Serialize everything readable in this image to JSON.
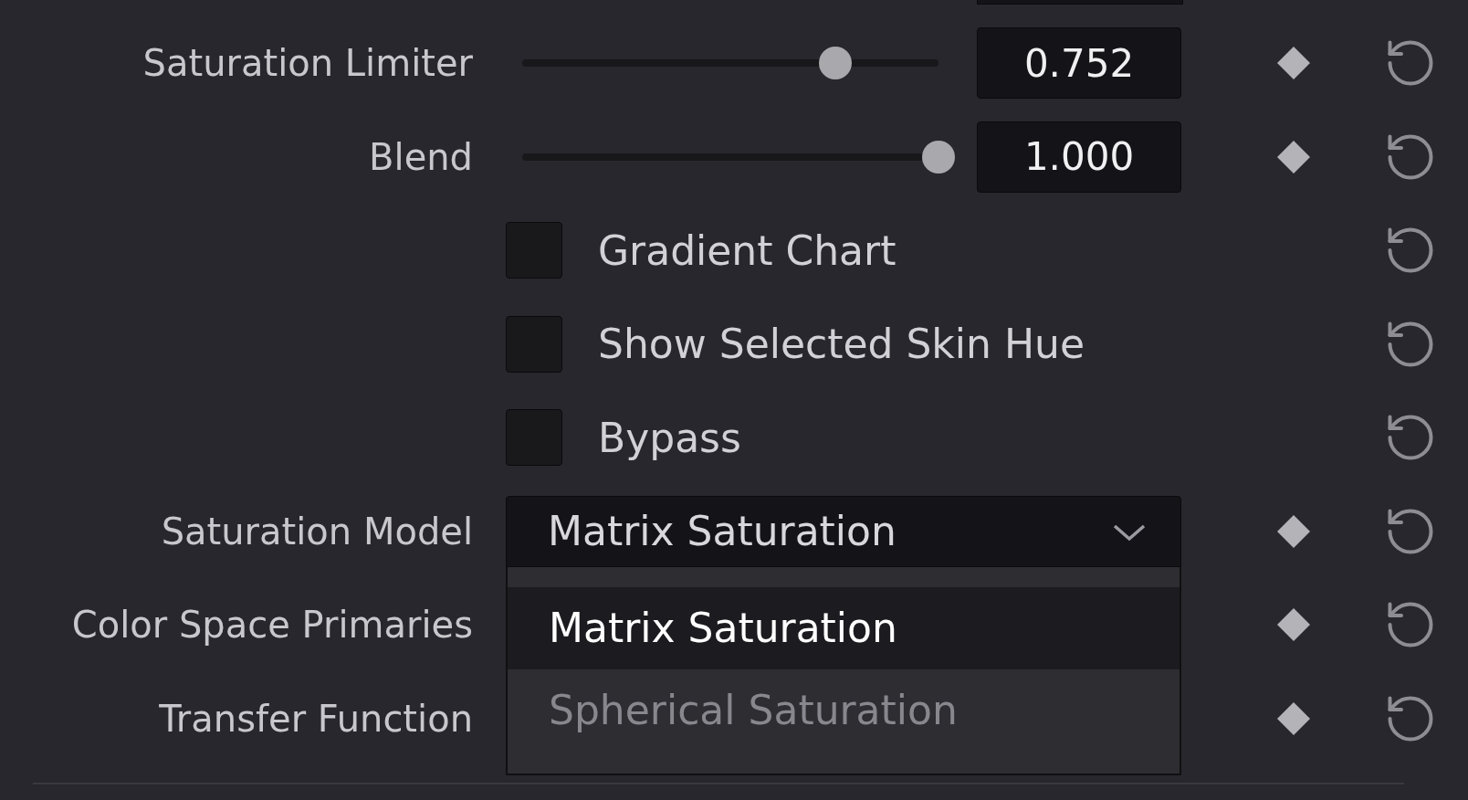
{
  "rows": [
    {
      "kind": "slider",
      "label": "Saturation Limiter",
      "level": 0.752,
      "value": "0.752",
      "keyframe": true
    },
    {
      "kind": "slider",
      "label": "Blend",
      "level": 1.0,
      "value": "1.000",
      "keyframe": true
    },
    {
      "kind": "checkbox",
      "label": "Gradient Chart",
      "checked": false,
      "keyframe": false
    },
    {
      "kind": "checkbox",
      "label": "Show Selected Skin Hue",
      "checked": false,
      "keyframe": false
    },
    {
      "kind": "checkbox",
      "label": "Bypass",
      "checked": false,
      "keyframe": false
    },
    {
      "kind": "dropdown",
      "label": "Saturation Model",
      "value": "Matrix Saturation",
      "expanded": true,
      "keyframe": true,
      "options": [
        {
          "label": "Matrix Saturation",
          "selected": true
        },
        {
          "label": "Spherical Saturation",
          "selected": false
        }
      ]
    },
    {
      "kind": "covered",
      "label": "Color Space Primaries",
      "keyframe": true
    },
    {
      "kind": "covered",
      "label": "Transfer Function",
      "keyframe": true
    }
  ]
}
